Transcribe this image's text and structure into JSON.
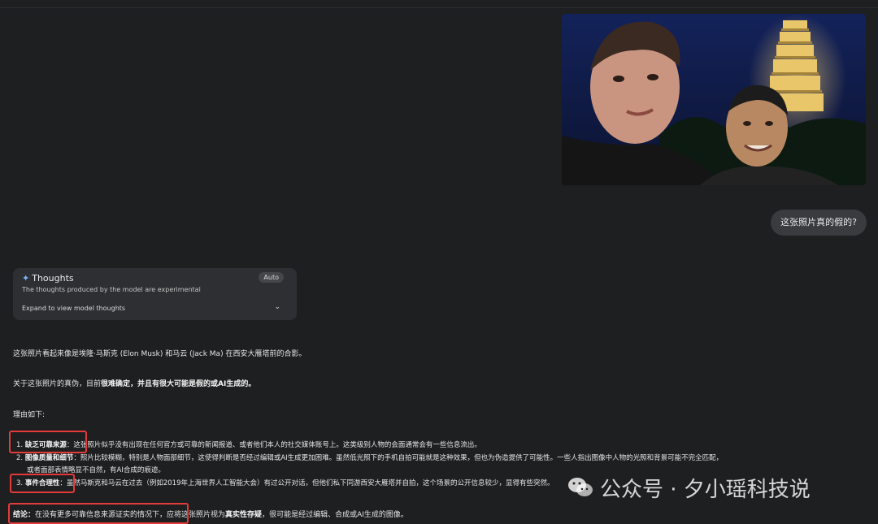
{
  "photo": {
    "alt": "selfie photo"
  },
  "user_message": "这张照片真的假的?",
  "thoughts_panel": {
    "title": "Thoughts",
    "subtitle": "The thoughts produced by the model are experimental",
    "badge": "Auto",
    "expand": "Expand to view model thoughts"
  },
  "answer": {
    "intro": "这张照片看起来像是埃隆·马斯克 (Elon Musk) 和马云 (Jack Ma) 在西安大雁塔前的合影。",
    "verdict_prefix": "关于这张照片的真伪，目前",
    "verdict_bold": "很难确定，并且有很大可能是假的或AI生成的。",
    "reasons_heading": "理由如下:",
    "reasons": [
      {
        "num": "1.",
        "bold": "缺乏可靠来源",
        "text": "：这张照片似乎没有出现在任何官方或可靠的新闻报道、或者他们本人的社交媒体账号上。这类级别人物的会面通常会有一些信息流出。"
      },
      {
        "num": "2.",
        "bold": "图像质量和细节",
        "text": "：照片比较模糊，特别是人物面部细节，这使得判断是否经过编辑或AI生成更加困难。虽然低光照下的手机自拍可能就是这种效果，但也为伪造提供了可能性。一些人指出图像中人物的光照和背景可能不完全匹配，",
        "text_cont": "或者面部表情略显不自然，有AI合成的痕迹。"
      },
      {
        "num": "3.",
        "bold": "事件合理性",
        "text": "：虽然马斯克和马云在过去（例如2019年上海世界人工智能大会）有过公开对话，但他们私下同游西安大雁塔并自拍，这个场景的公开信息较少，显得有些突然。"
      }
    ],
    "conclusion_label": "结论：",
    "conclusion_text_a": "在没有更多可靠信息来源证实的情况下，",
    "conclusion_text_b": "应将这张照片视为",
    "conclusion_bold": "真实性存疑",
    "conclusion_text_c": "，很可能是经过编辑、合成或AI生成的图像。"
  },
  "watermark": {
    "icon": "wechat-icon",
    "text": "公众号 · 夕小瑶科技说"
  },
  "colors": {
    "background": "#1e1f21",
    "highlight_box": "#e53a3a",
    "accent": "#7fb4ff"
  }
}
